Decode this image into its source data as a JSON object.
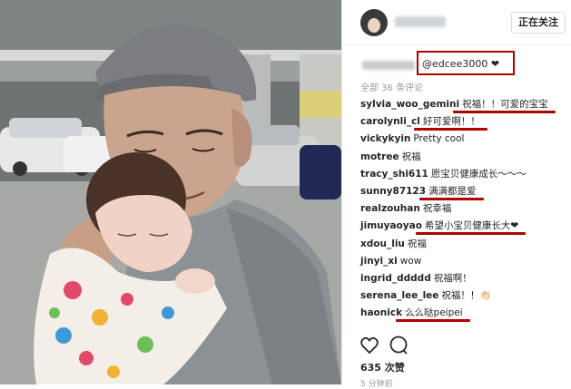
{
  "header": {
    "follow_label": "正在关注"
  },
  "caption": {
    "text": "@edcee3000 ❤"
  },
  "comments_header": "全部 36 条评论",
  "comments": [
    {
      "user": "sylvia_woo_gemini",
      "text": "祝福！！可爱的宝宝",
      "underlined": true
    },
    {
      "user": "carolynli_cl",
      "text": "好可爱啊！！",
      "underlined": true
    },
    {
      "user": "vickykyin",
      "text": "Pretty cool",
      "underlined": false
    },
    {
      "user": "motree",
      "text": "祝福",
      "underlined": false
    },
    {
      "user": "tracy_shi611",
      "text": "愿宝贝健康成长～～～",
      "underlined": false
    },
    {
      "user": "sunny87123",
      "text": "满满都是爱",
      "underlined": true
    },
    {
      "user": "realzouhan",
      "text": "祝幸福",
      "underlined": false
    },
    {
      "user": "jimuyaoyao",
      "text": "希望小宝贝健康长大❤",
      "underlined": true
    },
    {
      "user": "xdou_liu",
      "text": "祝福",
      "underlined": false
    },
    {
      "user": "jinyi_xi",
      "text": "wow",
      "underlined": false
    },
    {
      "user": "ingrid_ddddd",
      "text": "祝福啊！",
      "underlined": false
    },
    {
      "user": "serena_lee_lee",
      "text": "祝福！！👏🏻",
      "underlined": false
    },
    {
      "user": "haonick",
      "text": "么么哒peipei",
      "underlined": true
    }
  ],
  "likes": "635 次赞",
  "timestamp": "5 分钟前",
  "icons": {
    "like": "heart-icon",
    "comment": "comment-icon"
  },
  "colors": {
    "annotation_red": "#b00000"
  }
}
